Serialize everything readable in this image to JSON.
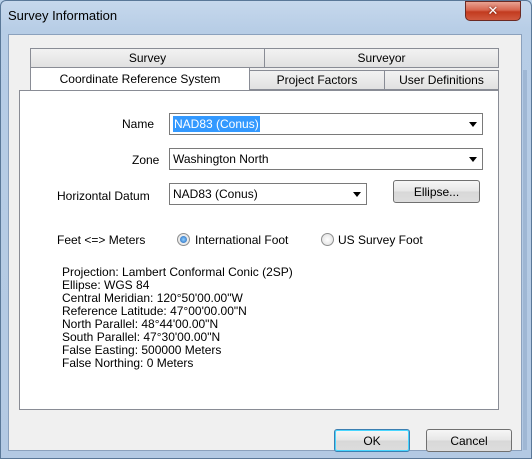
{
  "window": {
    "title": "Survey Information",
    "close_glyph": "✕"
  },
  "tabs": {
    "row_back": [
      "Survey",
      "Surveyor"
    ],
    "row_front": [
      "Coordinate Reference System",
      "Project Factors",
      "User Definitions"
    ],
    "active": "Coordinate Reference System"
  },
  "form": {
    "name_label": "Name",
    "name_value": "NAD83 (Conus)",
    "zone_label": "Zone",
    "zone_value": "Washington North",
    "datum_label": "Horizontal Datum",
    "datum_value": "NAD83 (Conus)",
    "ellipse_button": "Ellipse...",
    "units_label": "Feet <=> Meters",
    "radio_international": "International Foot",
    "radio_us_survey": "US Survey Foot",
    "selected_unit": "International Foot"
  },
  "info": [
    "Projection: Lambert Conformal Conic (2SP)",
    "Ellipse: WGS 84",
    "Central Meridian: 120°50'00.00\"W",
    "Reference Latitude: 47°00'00.00\"N",
    "North Parallel: 48°44'00.00\"N",
    "South Parallel: 47°30'00.00\"N",
    "False Easting: 500000 Meters",
    "False Northing: 0 Meters"
  ],
  "buttons": {
    "ok": "OK",
    "cancel": "Cancel"
  },
  "colors": {
    "selection": "#3399ff",
    "close_button": "#c23b1f",
    "frame": "#b9d1ea"
  }
}
